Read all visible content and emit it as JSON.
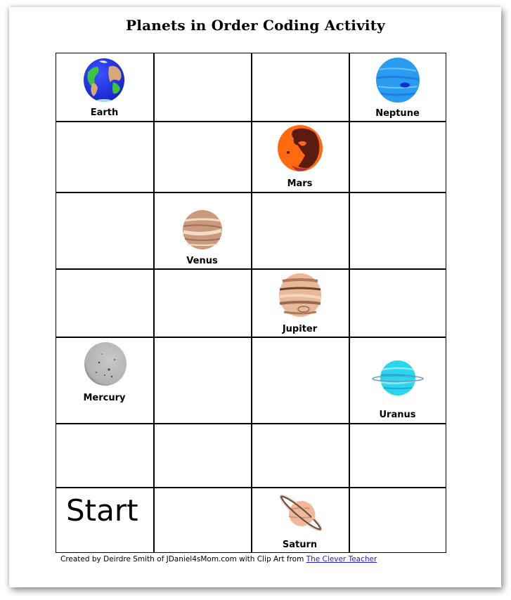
{
  "document": {
    "title": "Planets in Order Coding Activity",
    "grid": {
      "columns": 4,
      "rows": 7,
      "cells": [
        {
          "row": 1,
          "col": 1,
          "planet": "Earth",
          "icon": "earth-icon"
        },
        {
          "row": 1,
          "col": 4,
          "planet": "Neptune",
          "icon": "neptune-icon"
        },
        {
          "row": 2,
          "col": 3,
          "planet": "Mars",
          "icon": "mars-icon"
        },
        {
          "row": 3,
          "col": 2,
          "planet": "Venus",
          "icon": "venus-icon"
        },
        {
          "row": 4,
          "col": 3,
          "planet": "Jupiter",
          "icon": "jupiter-icon"
        },
        {
          "row": 5,
          "col": 1,
          "planet": "Mercury",
          "icon": "mercury-icon"
        },
        {
          "row": 5,
          "col": 4,
          "planet": "Uranus",
          "icon": "uranus-icon"
        },
        {
          "row": 7,
          "col": 3,
          "planet": "Saturn",
          "icon": "saturn-icon"
        }
      ],
      "start": {
        "row": 7,
        "col": 1,
        "label": "Start"
      }
    },
    "credit": {
      "text": "Created by Deirdre Smith of JDaniel4sMom.com with Clip Art from ",
      "link_text": "The Clever Teacher"
    },
    "colors": {
      "link": "#1a1aff",
      "grid_line": "#000000"
    }
  }
}
